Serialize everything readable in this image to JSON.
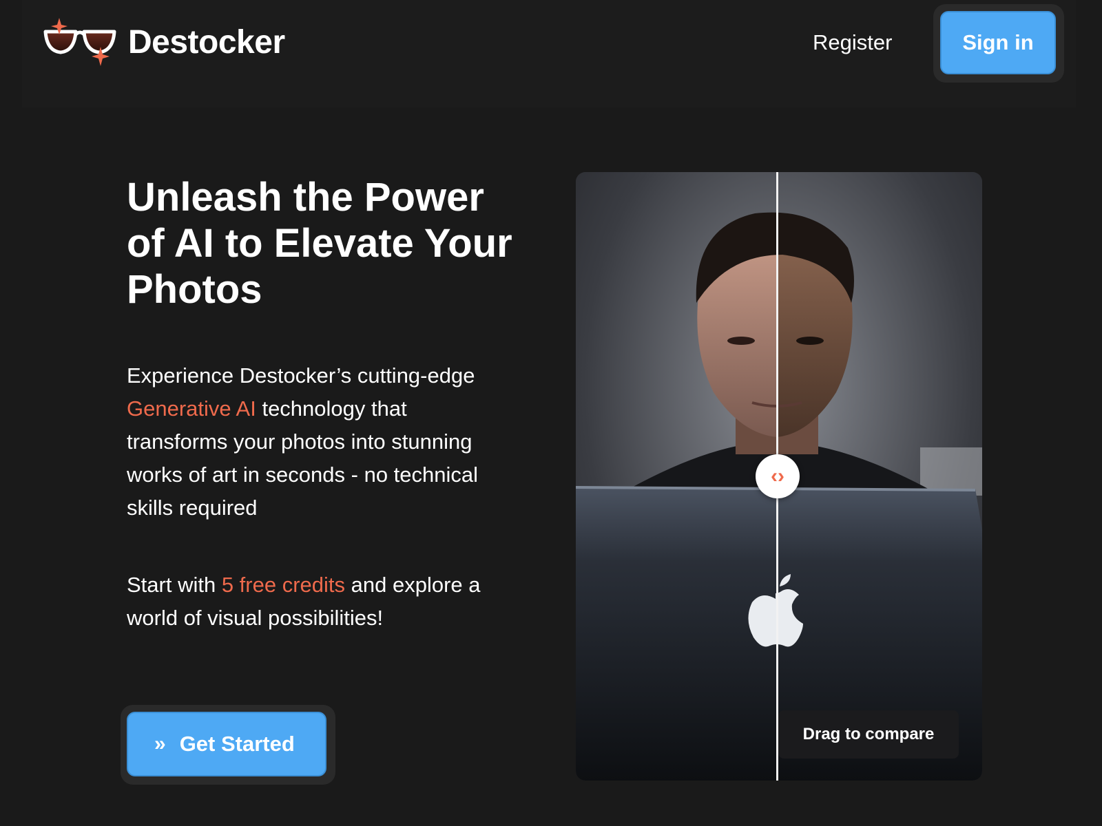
{
  "header": {
    "brand": "Destocker",
    "logo_icon": "sunglasses-sparkle-icon",
    "register_label": "Register",
    "signin_label": "Sign in"
  },
  "hero": {
    "headline": "Unleash the Power of AI to Elevate Your Photos",
    "p1_before": "Experience Destocker’s cutting-edge ",
    "p1_accent": "Generative AI",
    "p1_after": " technology that transforms your photos into stunning works of art in seconds - no technical skills required",
    "p2_before": "Start with ",
    "p2_accent": "5 free credits",
    "p2_after": " and explore a world of visual possibilities!",
    "cta_label": "Get Started",
    "cta_icon": "double-chevron-right-icon"
  },
  "compare": {
    "handle_icon": "code-arrows-icon",
    "handle_glyph": "‹›",
    "drag_label": "Drag to compare"
  },
  "colors": {
    "background": "#1a1a1a",
    "accent": "#ef6a4c",
    "button": "#4ea9f4"
  }
}
